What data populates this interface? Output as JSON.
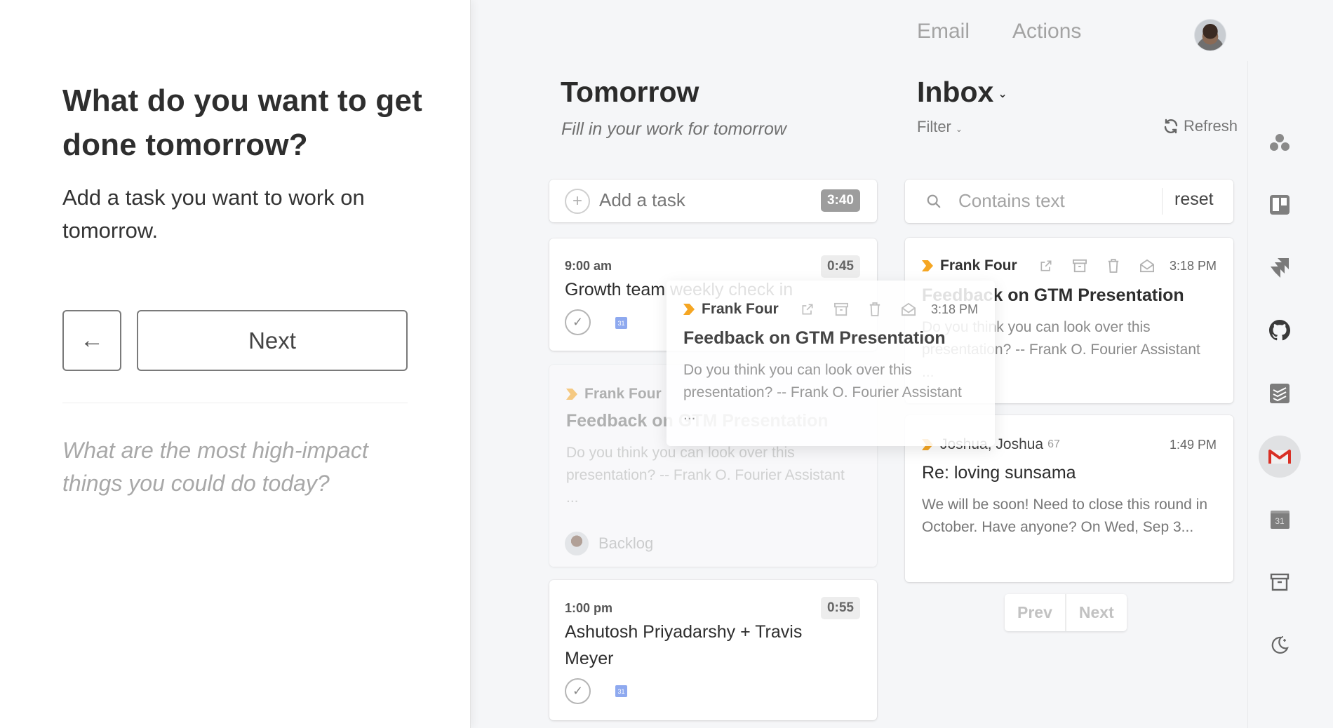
{
  "left_panel": {
    "title": "What do you want to get done tomorrow?",
    "subtitle": "Add a task you want to work on tomorrow.",
    "back_button": "←",
    "next_button": "Next",
    "prompt": "What are the most high-impact things you could do today?"
  },
  "top_nav": {
    "items": [
      "Email",
      "Actions"
    ],
    "avatar_icon": "user-avatar"
  },
  "tomorrow": {
    "title": "Tomorrow",
    "subtitle": "Fill in your work for tomorrow",
    "add_task": {
      "placeholder": "Add a task",
      "total_time": "3:40"
    },
    "tasks": [
      {
        "time": "9:00 am",
        "title": "Growth team weekly check in",
        "duration": "0:45",
        "calendar_icon": "31"
      },
      {
        "time": "1:00 pm",
        "title": "Ashutosh Priyadarshy + Travis Meyer",
        "duration": "0:55",
        "calendar_icon": "31"
      }
    ],
    "placeholder_card": {
      "from": "Frank Four",
      "subject": "Feedback on GTM Presentation",
      "preview": "Do you think you can look over this presentation? -- Frank O. Fourier Assistant ...",
      "channel": "Backlog"
    }
  },
  "drag_ghost": {
    "from": "Frank Four",
    "time": "3:18 PM",
    "subject": "Feedback on GTM Presentation",
    "preview": "Do you think you can look over this presentation? -- Frank O. Fourier Assistant ..."
  },
  "inbox": {
    "title": "Inbox",
    "filter_label": "Filter",
    "refresh_label": "Refresh",
    "search": {
      "placeholder": "Contains text",
      "reset_label": "reset"
    },
    "emails": [
      {
        "from": "Frank Four",
        "time": "3:18 PM",
        "subject": "Feedback on GTM Presentation",
        "preview": "Do you think you can look over this presentation? -- Frank O. Fourier Assistant ..."
      },
      {
        "from": "Joshua, Joshua",
        "count": "67",
        "time": "1:49 PM",
        "subject": "Re: loving sunsama",
        "preview": "We will be soon! Need to close this round in October. Have anyone? On Wed, Sep 3..."
      }
    ],
    "pager": {
      "prev": "Prev",
      "next": "Next"
    }
  },
  "right_sidebar": {
    "icons": [
      "asana-icon",
      "trello-icon",
      "jira-icon",
      "github-icon",
      "todoist-icon",
      "gmail-icon",
      "google-calendar-icon",
      "archive-icon",
      "moon-icon"
    ],
    "active": "gmail-icon",
    "calendar_day": "31"
  },
  "colors": {
    "accent_orange": "#f5a623",
    "gmail_red": "#d93025",
    "background": "#f5f6f8"
  }
}
